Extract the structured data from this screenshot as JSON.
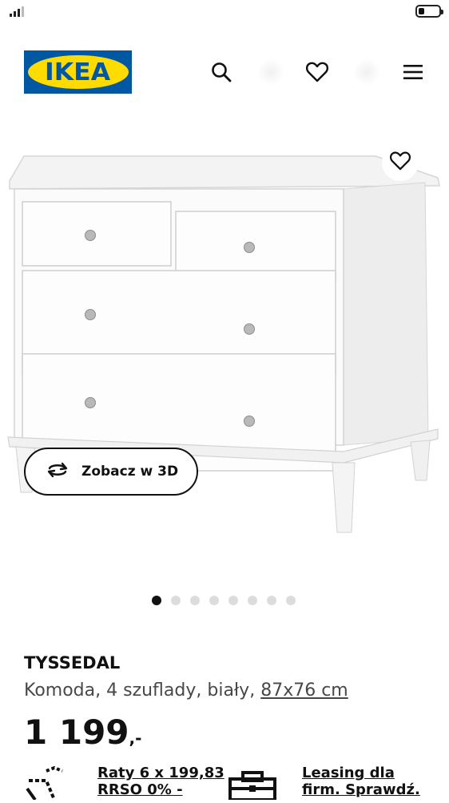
{
  "status_bar": {
    "battery_level": 0.3
  },
  "header": {
    "logo_text": "IKEA",
    "icons": [
      "search-icon",
      "heart-icon",
      "menu-icon"
    ]
  },
  "product": {
    "view_3d_label": "Zobacz w 3D",
    "carousel": {
      "total": 8,
      "active_index": 0
    },
    "name": "TYSSEDAL",
    "description": "Komoda, 4 szuflady, biały,",
    "dimensions": "87x76 cm",
    "price_main": "1 199",
    "price_decimal": ",-"
  },
  "promos": {
    "installments_line1": "Raty 6 x 199,83",
    "installments_line2": "RRSO 0% -",
    "leasing_line1": "Leasing dla",
    "leasing_line2": "firm. Sprawdź."
  },
  "colors": {
    "ikea_blue": "#0058a3",
    "ikea_yellow": "#ffdb00",
    "text": "#111111",
    "muted": "#484848"
  }
}
